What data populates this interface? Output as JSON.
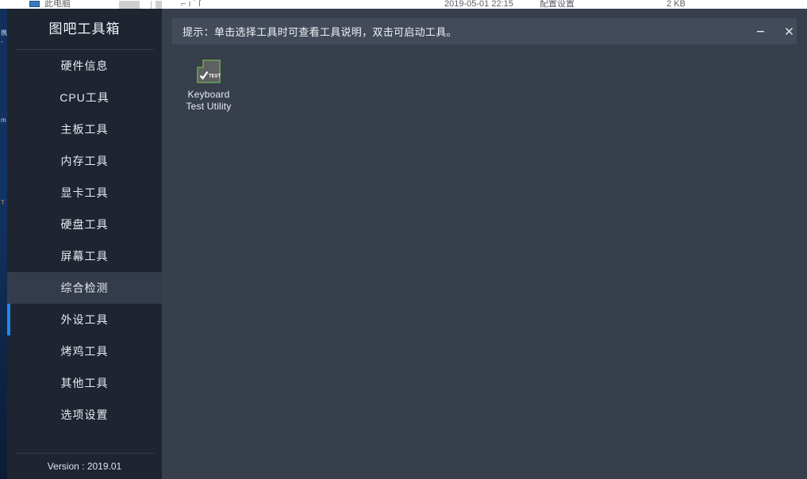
{
  "background_window": {
    "row_text_date": "2019-05-01 22:15",
    "row_text_type": "配置设置",
    "row_text_size": "2 KB",
    "shortcut_label": "此电脑",
    "left_fragments": [
      "携",
      "-",
      "m",
      "T"
    ]
  },
  "app": {
    "sidebar": {
      "title": "图吧工具箱",
      "items": [
        {
          "label": "硬件信息",
          "state": "normal"
        },
        {
          "label": "CPU工具",
          "state": "normal"
        },
        {
          "label": "主板工具",
          "state": "normal"
        },
        {
          "label": "内存工具",
          "state": "normal"
        },
        {
          "label": "显卡工具",
          "state": "normal"
        },
        {
          "label": "硬盘工具",
          "state": "normal"
        },
        {
          "label": "屏幕工具",
          "state": "normal"
        },
        {
          "label": "综合检测",
          "state": "hovered"
        },
        {
          "label": "外设工具",
          "state": "active"
        },
        {
          "label": "烤鸡工具",
          "state": "normal"
        },
        {
          "label": "其他工具",
          "state": "normal"
        },
        {
          "label": "选项设置",
          "state": "normal"
        }
      ],
      "version": "Version : 2019.01"
    },
    "titlebar": {
      "hint": "提示：单击选择工具时可查看工具说明，双击可启动工具。",
      "minimize_icon": "minimize-icon",
      "close_icon": "close-icon"
    },
    "tools": [
      {
        "name": "Keyboard Test Utility",
        "label_line1": "Keyboard",
        "label_line2": "Test Utility",
        "icon": "keyboard-test-utility-icon",
        "icon_badge_text": "TEST"
      }
    ]
  },
  "colors": {
    "sidebar_bg": "#1e2430",
    "content_bg": "#373e4c",
    "hint_bar_bg": "#434b5a",
    "accent_blue": "#1e88f0",
    "hover_bg": "#343c4b",
    "icon_green": "#6aa84f",
    "icon_gray": "#5f6063"
  }
}
